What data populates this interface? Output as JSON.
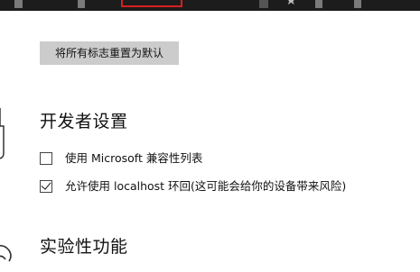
{
  "toolbar": {
    "icons": [
      "toolbar-icon",
      "toolbar-icon",
      "reading-view-icon",
      "favorites-star-icon",
      "toolbar-icon",
      "toolbar-icon"
    ],
    "focus_color": "#d62020"
  },
  "reset_button": {
    "label": "将所有标志重置为默认"
  },
  "developer_section": {
    "title": "开发者设置",
    "options": [
      {
        "label": "使用 Microsoft 兼容性列表",
        "checked": false
      },
      {
        "label": "允许使用 localhost 环回(这可能会给你的设备带来风险)",
        "checked": true
      }
    ]
  },
  "experimental_section": {
    "title": "实验性功能"
  }
}
